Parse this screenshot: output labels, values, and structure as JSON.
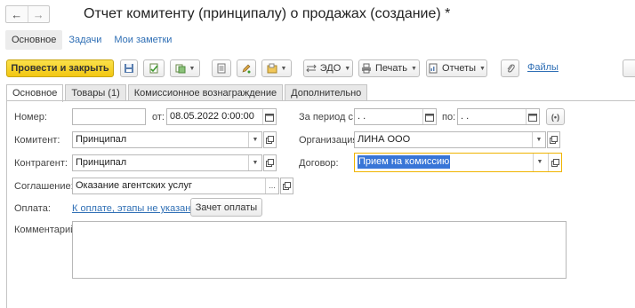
{
  "window": {
    "title": "Отчет комитенту (принципалу) о продажах (создание) *"
  },
  "nav": {
    "back_icon": "arrow-left-icon",
    "forward_icon": "arrow-right-icon"
  },
  "subnav": {
    "main": "Основное",
    "tasks": "Задачи",
    "notes": "Мои заметки"
  },
  "toolbar": {
    "post_close": "Провести и закрыть",
    "edo": "ЭДО",
    "print": "Печать",
    "reports": "Отчеты",
    "files": "Файлы"
  },
  "tabs": [
    {
      "label": "Основное",
      "active": true
    },
    {
      "label": "Товары (1)",
      "active": false
    },
    {
      "label": "Комиссионное вознаграждение",
      "active": false
    },
    {
      "label": "Дополнительно",
      "active": false
    }
  ],
  "form": {
    "number_label": "Номер:",
    "number_value": "",
    "from_label": "от:",
    "date_value": "08.05.2022  0:00:00",
    "period_label": "За период с:",
    "period_from": " .  .",
    "period_to_label": "по:",
    "period_to": " .  .",
    "committent_label": "Комитент:",
    "committent_value": "Принципал",
    "organization_label": "Организация:",
    "organization_value": "ЛИНА ООО",
    "counterparty_label": "Контрагент:",
    "counterparty_value": "Принципал",
    "contract_label": "Договор:",
    "contract_value": "Прием на комиссию",
    "agreement_label": "Соглашение:",
    "agreement_value": "Оказание агентских услуг",
    "payment_label": "Оплата:",
    "payment_link": "К оплате, этапы не указаны",
    "payment_offset_btn": "Зачет оплаты",
    "comment_label": "Комментарий:",
    "comment_value": ""
  },
  "colors": {
    "primary_button": "#f2c712",
    "link": "#2f6fb5",
    "focus_border": "#f0b400",
    "selection": "#3875d7"
  }
}
